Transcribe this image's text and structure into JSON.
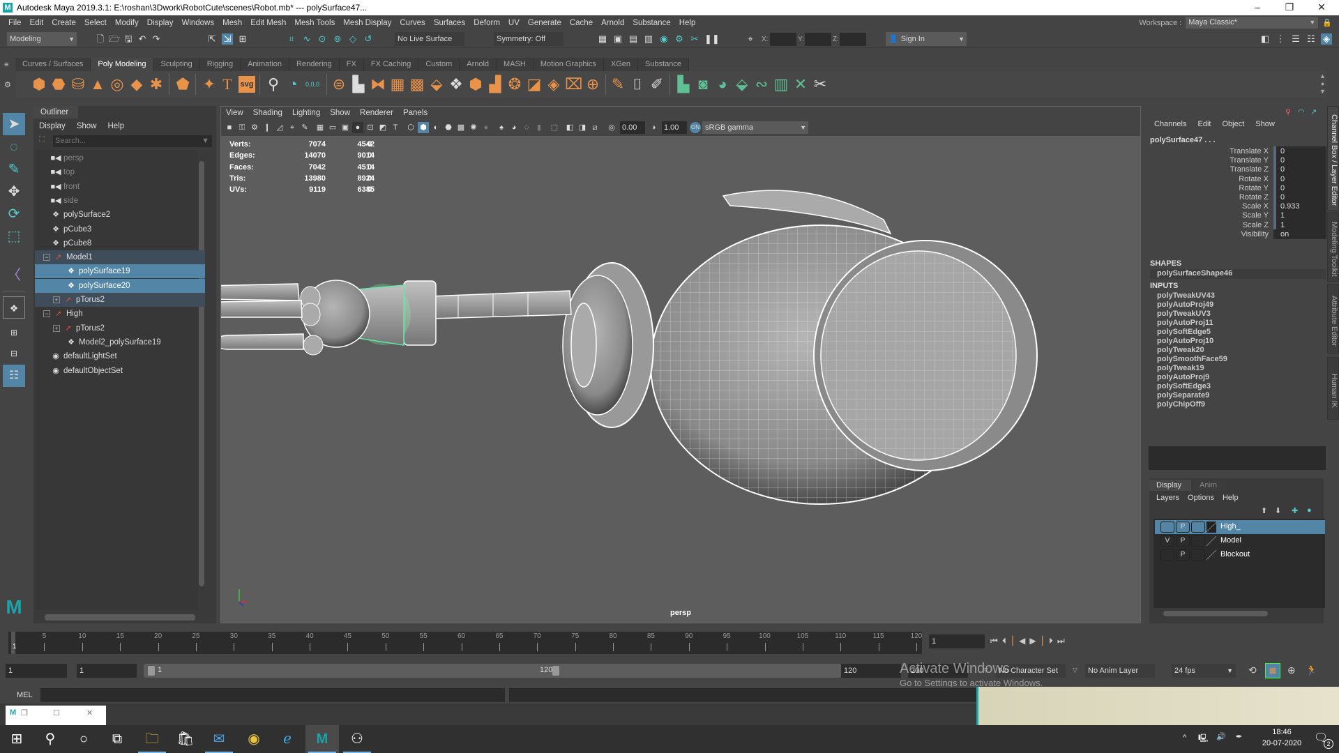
{
  "window": {
    "title": "Autodesk Maya 2019.3.1: E:\\roshan\\3Dwork\\RobotCute\\scenes\\Robot.mb*  ---  polySurface47...",
    "controls": {
      "minimize": "–",
      "maximize": "❐",
      "close": "✕"
    }
  },
  "menubar": {
    "items": [
      "File",
      "Edit",
      "Create",
      "Select",
      "Modify",
      "Display",
      "Windows",
      "Mesh",
      "Edit Mesh",
      "Mesh Tools",
      "Mesh Display",
      "Curves",
      "Surfaces",
      "Deform",
      "UV",
      "Generate",
      "Cache",
      "Arnold",
      "Substance",
      "Help"
    ],
    "workspace_label": "Workspace :",
    "workspace_value": "Maya Classic*"
  },
  "statusline": {
    "menuset": "Modeling",
    "live_surface": "No Live Surface",
    "symmetry": "Symmetry: Off",
    "x_label": "X:",
    "y_label": "Y:",
    "z_label": "Z:",
    "sign_in": "Sign In"
  },
  "shelf": {
    "tabs": [
      "Curves / Surfaces",
      "Poly Modeling",
      "Sculpting",
      "Rigging",
      "Animation",
      "Rendering",
      "FX",
      "FX Caching",
      "Custom",
      "Arnold",
      "MASH",
      "Motion Graphics",
      "XGen",
      "Substance"
    ],
    "active_tab": "Poly Modeling",
    "svg_label": "svg",
    "text_label": "T",
    "coord_label": "0,0,0"
  },
  "outliner": {
    "title": "Outliner",
    "menus": [
      "Display",
      "Show",
      "Help"
    ],
    "search_placeholder": "Search...",
    "items": [
      {
        "label": "persp",
        "type": "camera",
        "indent": 0
      },
      {
        "label": "top",
        "type": "camera",
        "indent": 0
      },
      {
        "label": "front",
        "type": "camera",
        "indent": 0
      },
      {
        "label": "side",
        "type": "camera",
        "indent": 0
      },
      {
        "label": "polySurface2",
        "type": "mesh",
        "indent": 0
      },
      {
        "label": "pCube3",
        "type": "mesh",
        "indent": 0
      },
      {
        "label": "pCube8",
        "type": "mesh",
        "indent": 0
      },
      {
        "label": "Model1",
        "type": "group",
        "indent": 0,
        "expanded": true
      },
      {
        "label": "polySurface19",
        "type": "mesh",
        "indent": 1,
        "selected": true
      },
      {
        "label": "polySurface20",
        "type": "mesh",
        "indent": 1,
        "selected": true
      },
      {
        "label": "pTorus2",
        "type": "group",
        "indent": 1,
        "collapsed": true
      },
      {
        "label": "High",
        "type": "group",
        "indent": 0,
        "expanded": true
      },
      {
        "label": "pTorus2",
        "type": "group",
        "indent": 1,
        "collapsed": true
      },
      {
        "label": "Model2_polySurface19",
        "type": "mesh",
        "indent": 1
      },
      {
        "label": "defaultLightSet",
        "type": "set",
        "indent": 0
      },
      {
        "label": "defaultObjectSet",
        "type": "set",
        "indent": 0
      }
    ]
  },
  "viewport": {
    "menus": [
      "View",
      "Shading",
      "Lighting",
      "Show",
      "Renderer",
      "Panels"
    ],
    "exposure": "0.00",
    "gamma": "1.00",
    "color_space": "sRGB gamma",
    "camera": "persp",
    "hud": [
      {
        "label": "Verts:",
        "values": [
          "7074",
          "4542",
          "0"
        ]
      },
      {
        "label": "Edges:",
        "values": [
          "14070",
          "9014",
          "0"
        ]
      },
      {
        "label": "Faces:",
        "values": [
          "7042",
          "4514",
          "0"
        ]
      },
      {
        "label": "Tris:",
        "values": [
          "13980",
          "8924",
          "0"
        ]
      },
      {
        "label": "UVs:",
        "values": [
          "9119",
          "6385",
          "0"
        ]
      }
    ]
  },
  "channelbox": {
    "menus": [
      "Channels",
      "Edit",
      "Object",
      "Show"
    ],
    "object": "polySurface47 . . .",
    "channels": [
      {
        "label": "Translate X",
        "value": "0"
      },
      {
        "label": "Translate Y",
        "value": "0"
      },
      {
        "label": "Translate Z",
        "value": "0"
      },
      {
        "label": "Rotate X",
        "value": "0"
      },
      {
        "label": "Rotate Y",
        "value": "0"
      },
      {
        "label": "Rotate Z",
        "value": "0"
      },
      {
        "label": "Scale X",
        "value": "0.933"
      },
      {
        "label": "Scale Y",
        "value": "1"
      },
      {
        "label": "Scale Z",
        "value": "1"
      },
      {
        "label": "Visibility",
        "value": "on"
      }
    ],
    "shapes_header": "SHAPES",
    "shape": "polySurfaceShape46",
    "inputs_header": "INPUTS",
    "inputs": [
      "polyTweakUV43",
      "polyAutoProj49",
      "polyTweakUV3",
      "polyAutoProj11",
      "polySoftEdge5",
      "polyAutoProj10",
      "polyTweak20",
      "polySmoothFace59",
      "polyTweak19",
      "polyAutoProj9",
      "polySoftEdge3",
      "polySeparate9",
      "polyChipOff9"
    ]
  },
  "side_tabs": [
    "Channel Box / Layer Editor",
    "Modeling Toolkit",
    "Attribute Editor",
    "Human IK"
  ],
  "layers": {
    "tabs": [
      "Display",
      "Anim"
    ],
    "menus": [
      "Layers",
      "Options",
      "Help"
    ],
    "rows": [
      {
        "name": "High_",
        "v": "",
        "p": "P",
        "selected": true
      },
      {
        "name": "Model",
        "v": "V",
        "p": "P",
        "selected": false
      },
      {
        "name": "Blockout",
        "v": "",
        "p": "P",
        "selected": false
      }
    ]
  },
  "timeline": {
    "ticks": [
      "5",
      "10",
      "15",
      "20",
      "25",
      "30",
      "35",
      "40",
      "45",
      "50",
      "55",
      "60",
      "65",
      "70",
      "75",
      "80",
      "85",
      "90",
      "95",
      "100",
      "105",
      "110",
      "115",
      "120"
    ],
    "current_frame": "1",
    "current_frame_field": "1"
  },
  "range": {
    "start": "1",
    "anim_start": "1",
    "range_start": "1",
    "range_end": "120",
    "anim_end": "120",
    "end": "200",
    "character_set": "No Character Set",
    "anim_layer": "No Anim Layer",
    "fps": "24 fps"
  },
  "cmdline": {
    "label": "MEL"
  },
  "watermark": {
    "title": "Activate Windows",
    "subtitle": "Go to Settings to activate Windows."
  },
  "taskbar": {
    "time": "18:46",
    "date": "20-07-2020",
    "notifications": "2"
  }
}
